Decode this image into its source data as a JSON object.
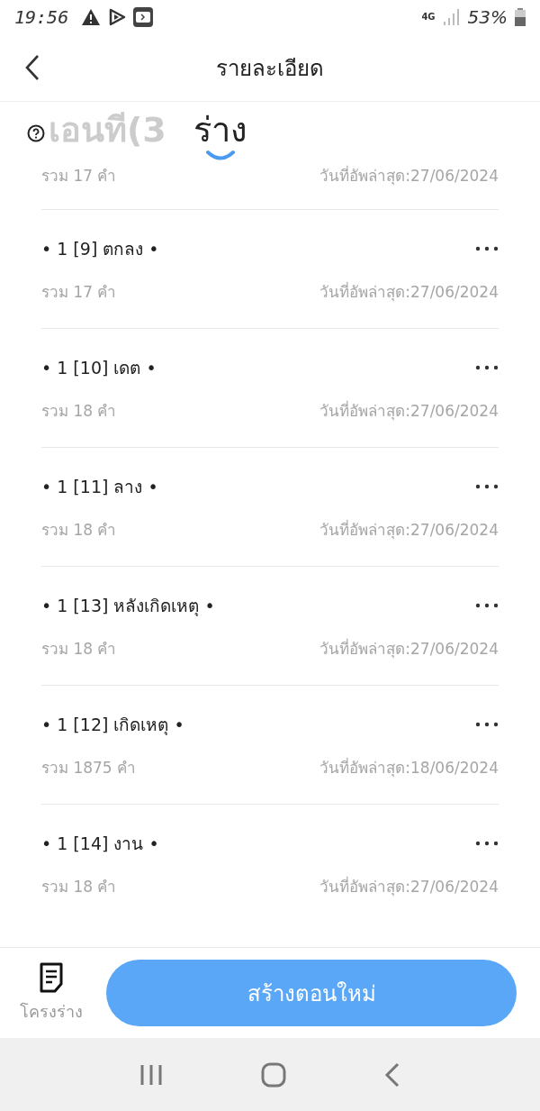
{
  "status_bar": {
    "time": "19:56",
    "network": "4G",
    "battery": "53%"
  },
  "header": {
    "title": "รายละเอียด"
  },
  "tabs": [
    {
      "label": "เอนที(3",
      "selected": false
    },
    {
      "label": "ร่าง",
      "selected": true
    }
  ],
  "items": [
    {
      "count": "รวม 17 คำ",
      "date": "วันที่อัพล่าสุด:27/06/2024"
    },
    {
      "title": "• 1 [9] ตกลง •",
      "count": "รวม 17 คำ",
      "date": "วันที่อัพล่าสุด:27/06/2024"
    },
    {
      "title": "• 1 [10] เดต •",
      "count": "รวม 18 คำ",
      "date": "วันที่อัพล่าสุด:27/06/2024"
    },
    {
      "title": "• 1 [11] ลาง •",
      "count": "รวม 18 คำ",
      "date": "วันที่อัพล่าสุด:27/06/2024"
    },
    {
      "title": "• 1 [13] หลังเกิดเหตุ •",
      "count": "รวม 18 คำ",
      "date": "วันที่อัพล่าสุด:27/06/2024"
    },
    {
      "title": "• 1 [12] เกิดเหตุ •",
      "count": "รวม 1875 คำ",
      "date": "วันที่อัพล่าสุด:18/06/2024"
    },
    {
      "title": "• 1 [14] งาน •",
      "count": "รวม 18 คำ",
      "date": "วันที่อัพล่าสุด:27/06/2024"
    }
  ],
  "bottom_bar": {
    "outline_label": "โครงร่าง",
    "create_button": "สร้างตอนใหม่"
  }
}
